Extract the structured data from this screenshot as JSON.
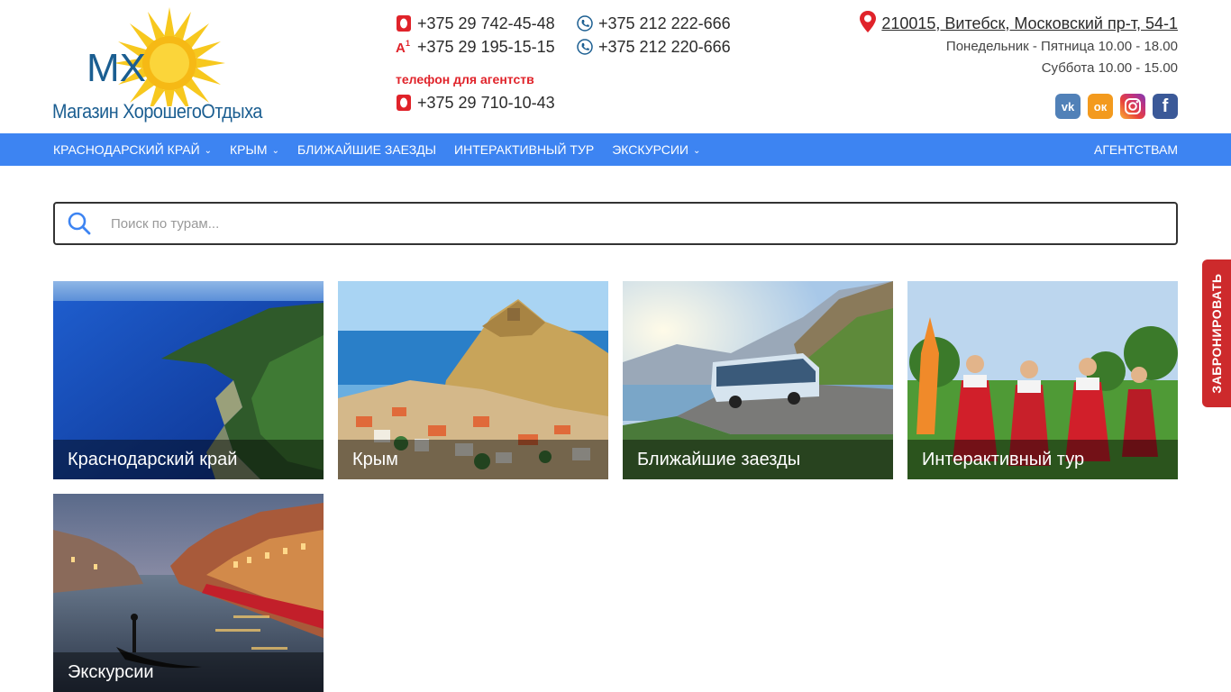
{
  "logo": {
    "mark": "MX",
    "text": "Магазин ХорошегоОтдыха"
  },
  "phones": [
    {
      "operator": "mts",
      "number": "+375 29 742-45-48"
    },
    {
      "operator": "a1",
      "number": "+375 29 195-15-15"
    },
    {
      "operator": "landline",
      "number": "+375 212 222-666"
    },
    {
      "operator": "landline",
      "number": "+375 212 220-666"
    }
  ],
  "agency": {
    "label": "телефон для агентств",
    "number": "+375 29 710-10-43"
  },
  "contacts": {
    "address": "210015, Витебск, Московский пр-т, 54-1",
    "hours_weekdays": "Понедельник - Пятница 10.00 - 18.00",
    "hours_saturday": "Суббота 10.00 - 15.00"
  },
  "socials": [
    {
      "name": "vk-icon",
      "glyph": "vk"
    },
    {
      "name": "odnoklassniki-icon",
      "glyph": "ок"
    },
    {
      "name": "instagram-icon",
      "glyph": ""
    },
    {
      "name": "facebook-icon",
      "glyph": "f"
    }
  ],
  "nav": {
    "items": [
      {
        "label": "Краснодарский край",
        "dropdown": true
      },
      {
        "label": "Крым",
        "dropdown": true
      },
      {
        "label": "Ближайшие заезды",
        "dropdown": false
      },
      {
        "label": "Интерактивный тур",
        "dropdown": false
      },
      {
        "label": "Экскурсии",
        "dropdown": true
      }
    ],
    "right": "Агентствам"
  },
  "search": {
    "placeholder": "Поиск по турам..."
  },
  "cards": [
    {
      "label": "Краснодарский край"
    },
    {
      "label": "Крым"
    },
    {
      "label": "Ближайшие заезды"
    },
    {
      "label": "Интерактивный тур"
    },
    {
      "label": "Экскурсии"
    }
  ],
  "book_tab": "ЗАБРОНИРОВАТЬ",
  "colors": {
    "nav": "#3d84f2",
    "accent_red": "#e0232a",
    "book": "#cd2a2c",
    "logo_blue": "#1b5e91",
    "sun": "#f7c81e"
  }
}
